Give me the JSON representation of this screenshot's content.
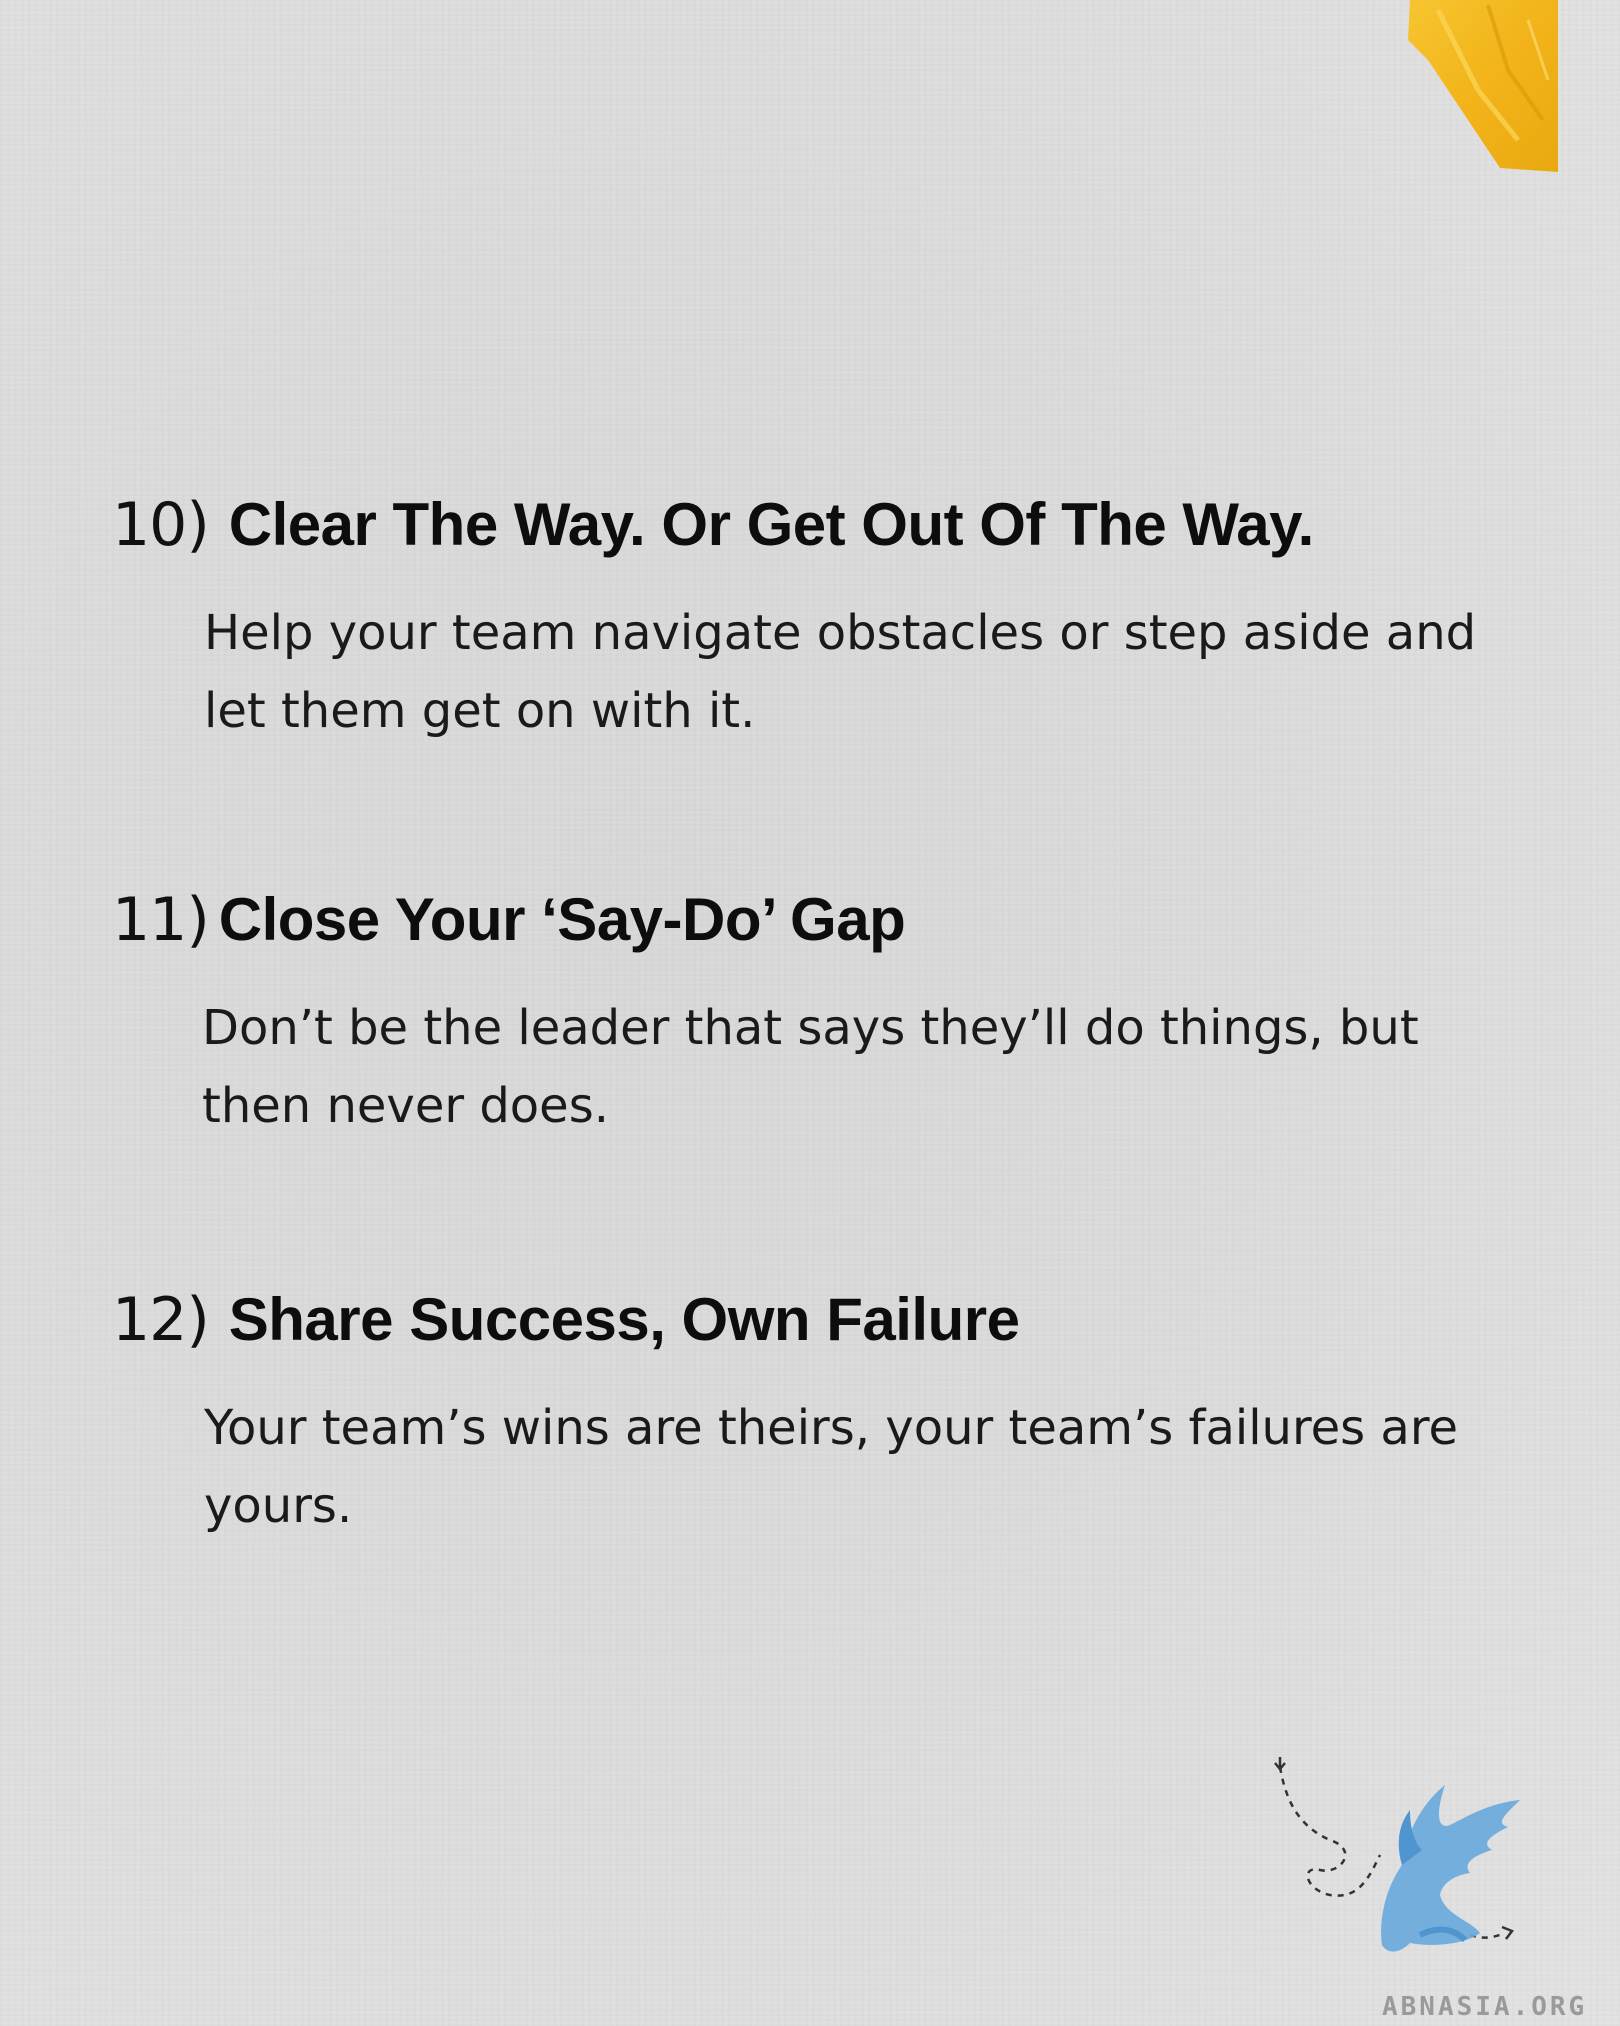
{
  "items": [
    {
      "number": "10)",
      "title": "Clear The Way. Or Get Out Of The Way.",
      "body": "Help your team navigate obstacles or step aside and let them get on with it."
    },
    {
      "number": "11)",
      "title": "Close Your ‘Say-Do’ Gap",
      "body": "Don’t be the leader that says they’ll do things, but then never does."
    },
    {
      "number": "12)",
      "title": "Share Success, Own Failure",
      "body": "Your team’s wins are theirs, your team’s failures are yours."
    }
  ],
  "branding": {
    "logo_text": "ABNASIA.ORG",
    "logo_icon": "winged-dragon-icon",
    "accent_tape_color": "#f5b921",
    "logo_color": "#6aa9dc"
  }
}
